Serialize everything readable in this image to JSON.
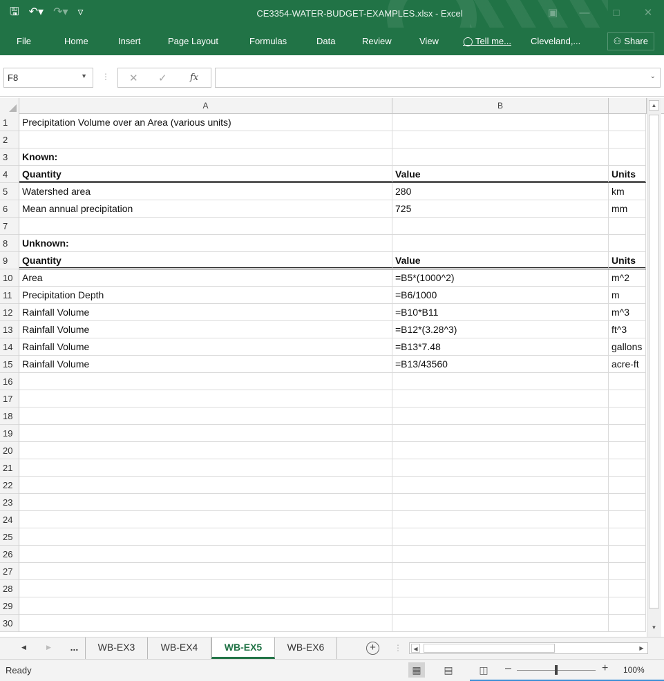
{
  "window": {
    "title": "CE3354-WATER-BUDGET-EXAMPLES.xlsx - Excel"
  },
  "ribbon": {
    "tabs": [
      "File",
      "Home",
      "Insert",
      "Page Layout",
      "Formulas",
      "Data",
      "Review",
      "View"
    ],
    "tell_me": "Tell me...",
    "account": "Cleveland,...",
    "share": "Share"
  },
  "formula_bar": {
    "name_box": "F8",
    "fx_label": "fx",
    "formula": ""
  },
  "columns": [
    "A",
    "B"
  ],
  "rows": [
    {
      "n": "1",
      "a": "Precipitation Volume over an Area (various units)",
      "b": "",
      "c": ""
    },
    {
      "n": "2",
      "a": "",
      "b": "",
      "c": ""
    },
    {
      "n": "3",
      "a": "Known:",
      "b": "",
      "c": ""
    },
    {
      "n": "4",
      "a": "Quantity",
      "b": "Value",
      "c": "Units"
    },
    {
      "n": "5",
      "a": "Watershed area",
      "b": "280",
      "c": "km"
    },
    {
      "n": "6",
      "a": "Mean annual precipitation",
      "b": "725",
      "c": "mm"
    },
    {
      "n": "7",
      "a": "",
      "b": "",
      "c": ""
    },
    {
      "n": "8",
      "a": "Unknown:",
      "b": "",
      "c": ""
    },
    {
      "n": "9",
      "a": "Quantity",
      "b": "Value",
      "c": "Units"
    },
    {
      "n": "10",
      "a": "Area",
      "b": "=B5*(1000^2)",
      "c": "m^2"
    },
    {
      "n": "11",
      "a": "Precipitation Depth",
      "b": "=B6/1000",
      "c": "m"
    },
    {
      "n": "12",
      "a": "Rainfall Volume",
      "b": "=B10*B11",
      "c": "m^3"
    },
    {
      "n": "13",
      "a": "Rainfall Volume",
      "b": "=B12*(3.28^3)",
      "c": "ft^3"
    },
    {
      "n": "14",
      "a": "Rainfall Volume",
      "b": "=B13*7.48",
      "c": "gallons"
    },
    {
      "n": "15",
      "a": "Rainfall Volume",
      "b": "=B13/43560",
      "c": "acre-ft"
    },
    {
      "n": "16",
      "a": "",
      "b": "",
      "c": ""
    },
    {
      "n": "17",
      "a": "",
      "b": "",
      "c": ""
    },
    {
      "n": "18",
      "a": "",
      "b": "",
      "c": ""
    },
    {
      "n": "19",
      "a": "",
      "b": "",
      "c": ""
    },
    {
      "n": "20",
      "a": "",
      "b": "",
      "c": ""
    },
    {
      "n": "21",
      "a": "",
      "b": "",
      "c": ""
    },
    {
      "n": "22",
      "a": "",
      "b": "",
      "c": ""
    },
    {
      "n": "23",
      "a": "",
      "b": "",
      "c": ""
    },
    {
      "n": "24",
      "a": "",
      "b": "",
      "c": ""
    },
    {
      "n": "25",
      "a": "",
      "b": "",
      "c": ""
    },
    {
      "n": "26",
      "a": "",
      "b": "",
      "c": ""
    },
    {
      "n": "27",
      "a": "",
      "b": "",
      "c": ""
    },
    {
      "n": "28",
      "a": "",
      "b": "",
      "c": ""
    },
    {
      "n": "29",
      "a": "",
      "b": "",
      "c": ""
    },
    {
      "n": "30",
      "a": "",
      "b": "",
      "c": ""
    }
  ],
  "bold_rows": [
    "3",
    "4",
    "8",
    "9"
  ],
  "header_rows": [
    "4",
    "9"
  ],
  "sheet_tabs": {
    "ellipsis": "...",
    "tabs": [
      "WB-EX3",
      "WB-EX4",
      "WB-EX5",
      "WB-EX6"
    ],
    "active": "WB-EX5"
  },
  "status": {
    "text": "Ready",
    "zoom": "100%"
  },
  "colors": {
    "accent": "#217346"
  }
}
